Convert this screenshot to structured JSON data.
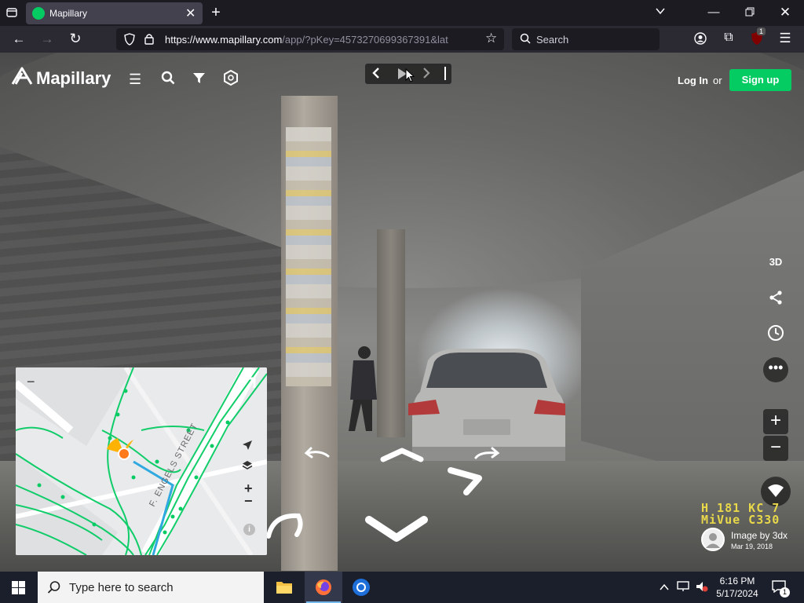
{
  "browser": {
    "tab_title": "Mapillary",
    "url_host": "https://www.mapillary.com",
    "url_rest": "/app/?pKey=4573270699367391&lat",
    "search_placeholder": "Search",
    "extension_badge": "1"
  },
  "app": {
    "logo_text": "Mapillary",
    "login_label": "Log In",
    "or_text": "or",
    "signup_label": "Sign up",
    "view_3d_label": "3D",
    "brand_color": "#05cb63"
  },
  "scene": {
    "dashcam_line1": "H 181 KC 7",
    "dashcam_line2": "MiVue C330"
  },
  "map": {
    "street_label": "F. ENGELS STREET"
  },
  "attribution": {
    "text": "Image by 3dx",
    "date": "Mar 19, 2018"
  },
  "taskbar": {
    "search_placeholder": "Type here to search",
    "time": "6:16 PM",
    "date": "5/17/2024",
    "notification_count": "1"
  }
}
